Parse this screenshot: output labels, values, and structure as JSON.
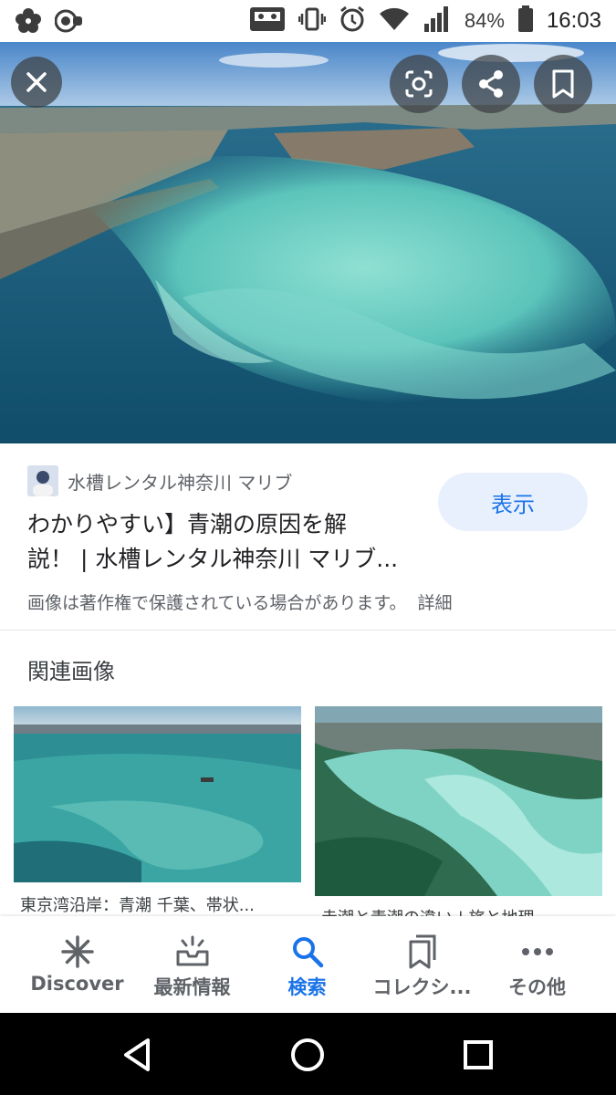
{
  "status_bar": {
    "battery_percent": "84%",
    "time": "16:03"
  },
  "hero": {
    "close_icon": "close-icon",
    "actions": [
      "lens-icon",
      "share-icon",
      "bookmark-icon"
    ]
  },
  "result": {
    "source_name": "水槽レンタル神奈川 マリブ",
    "title_line1": "わかりやすい】青潮の原因を解",
    "title_line2": "説！ | 水槽レンタル神奈川 マリブ...",
    "view_button": "表示",
    "copyright_notice": "画像は著作権で保護されている場合があります。",
    "details_link": "詳細"
  },
  "related": {
    "heading": "関連画像",
    "items": [
      {
        "caption": "東京湾沿岸：青潮 千葉、帯状..."
      },
      {
        "caption": "赤潮と青潮の違い | 旅と地理..."
      }
    ]
  },
  "bottom_nav": {
    "items": [
      {
        "label": "Discover",
        "icon": "discover-icon"
      },
      {
        "label": "最新情報",
        "icon": "updates-icon"
      },
      {
        "label": "検索",
        "icon": "search-icon",
        "active": true
      },
      {
        "label": "コレクシ...",
        "icon": "collections-icon"
      },
      {
        "label": "その他",
        "icon": "more-icon"
      }
    ]
  },
  "colors": {
    "accent": "#1a73e8",
    "view_button_bg": "#e8f0fe",
    "hero_overlay_button": "#3c4043"
  }
}
